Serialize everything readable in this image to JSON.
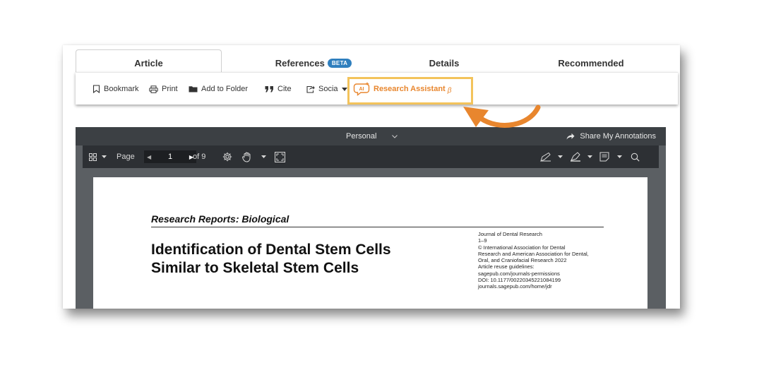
{
  "tabs": [
    {
      "label": "Article",
      "active": true
    },
    {
      "label": "References",
      "badge": "BETA"
    },
    {
      "label": "Details"
    },
    {
      "label": "Recommended"
    }
  ],
  "actions": {
    "bookmark": "Bookmark",
    "print": "Print",
    "add_to_folder": "Add to Folder",
    "cite": "Cite",
    "social": "Socia",
    "research_assistant": "Research Assistant",
    "research_assistant_beta": "β",
    "ai_icon_text": "AI"
  },
  "viewer": {
    "annotation_set": "Personal",
    "share_label": "Share My Annotations",
    "page_label": "Page",
    "current_page": "1",
    "page_total": "of 9"
  },
  "document": {
    "kicker": "Research Reports: Biological",
    "title_line1": "Identification of Dental Stem Cells",
    "title_line2": "Similar to Skeletal Stem Cells",
    "meta": [
      "Journal of Dental Research",
      "1–9",
      "© International Association for Dental",
      "Research and American Association for Dental,",
      "Oral, and Craniofacial Research 2022",
      "Article reuse guidelines:",
      "sagepub.com/journals-permissions",
      "DOI: 10.1177/00220345221084199",
      "journals.sagepub.com/home/jdr"
    ]
  },
  "colors": {
    "accent_orange": "#e8862e",
    "highlight_yellow": "#f3c35b",
    "beta_blue": "#2f7fbe",
    "viewer_dark": "#2d3034"
  },
  "icons": [
    "bookmark-icon",
    "print-icon",
    "folder-icon",
    "quote-icon",
    "share-icon",
    "ai-chat-icon",
    "grid-icon",
    "settings-icon",
    "hand-pan-icon",
    "fit-page-icon",
    "pen-icon",
    "highlighter-icon",
    "note-icon",
    "search-icon",
    "chevron-down-icon",
    "curved-arrow-icon"
  ]
}
